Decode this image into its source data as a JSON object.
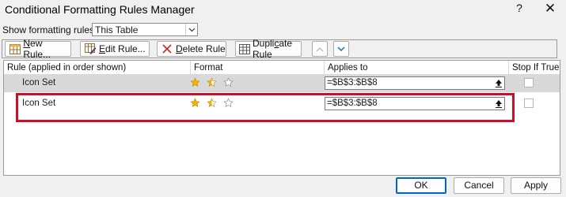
{
  "window": {
    "title": "Conditional Formatting Rules Manager"
  },
  "icons": {
    "help": "help-icon",
    "close": "close-icon",
    "new_rule": "new-rule-icon",
    "edit_rule": "edit-rule-icon",
    "delete_rule": "delete-x-icon",
    "duplicate_rule": "duplicate-rule-icon",
    "move_up": "chevron-up-icon",
    "move_down": "chevron-down-icon",
    "collapse": "collapse-dialog-icon",
    "star": "star-icon"
  },
  "titlebar": {
    "help_glyph": "?",
    "close_glyph": "✕"
  },
  "filter": {
    "label": "Show formatting rules for:",
    "value": "This Table"
  },
  "toolbar": {
    "new_rule": {
      "hotkey": "N",
      "rest": "ew Rule..."
    },
    "edit_rule": {
      "hotkey": "E",
      "rest": "dit Rule..."
    },
    "delete_rule": {
      "hotkey": "D",
      "rest": "elete Rule"
    },
    "duplicate_rule": {
      "pre": "Dupli",
      "hotkey": "c",
      "post": "ate Rule"
    }
  },
  "columns": {
    "rule": "Rule (applied in order shown)",
    "format": "Format",
    "applies_to": "Applies to",
    "stop_if_true": "Stop If True"
  },
  "rules": [
    {
      "name": "Icon Set",
      "format": "icon-set-stars",
      "applies_to": "=$B$3:$B$8",
      "stop_if_true": false,
      "selected": true
    },
    {
      "name": "Icon Set",
      "format": "icon-set-stars",
      "applies_to": "=$B$3:$B$8",
      "stop_if_true": false,
      "selected": false
    }
  ],
  "colors": {
    "selected_row": "#d9d9d9",
    "highlight_box": "#c8102e",
    "star_gold": "#f4b400",
    "star_outline": "#8a8a8a"
  },
  "footer": {
    "ok": "OK",
    "cancel": "Cancel",
    "apply": "Apply"
  }
}
